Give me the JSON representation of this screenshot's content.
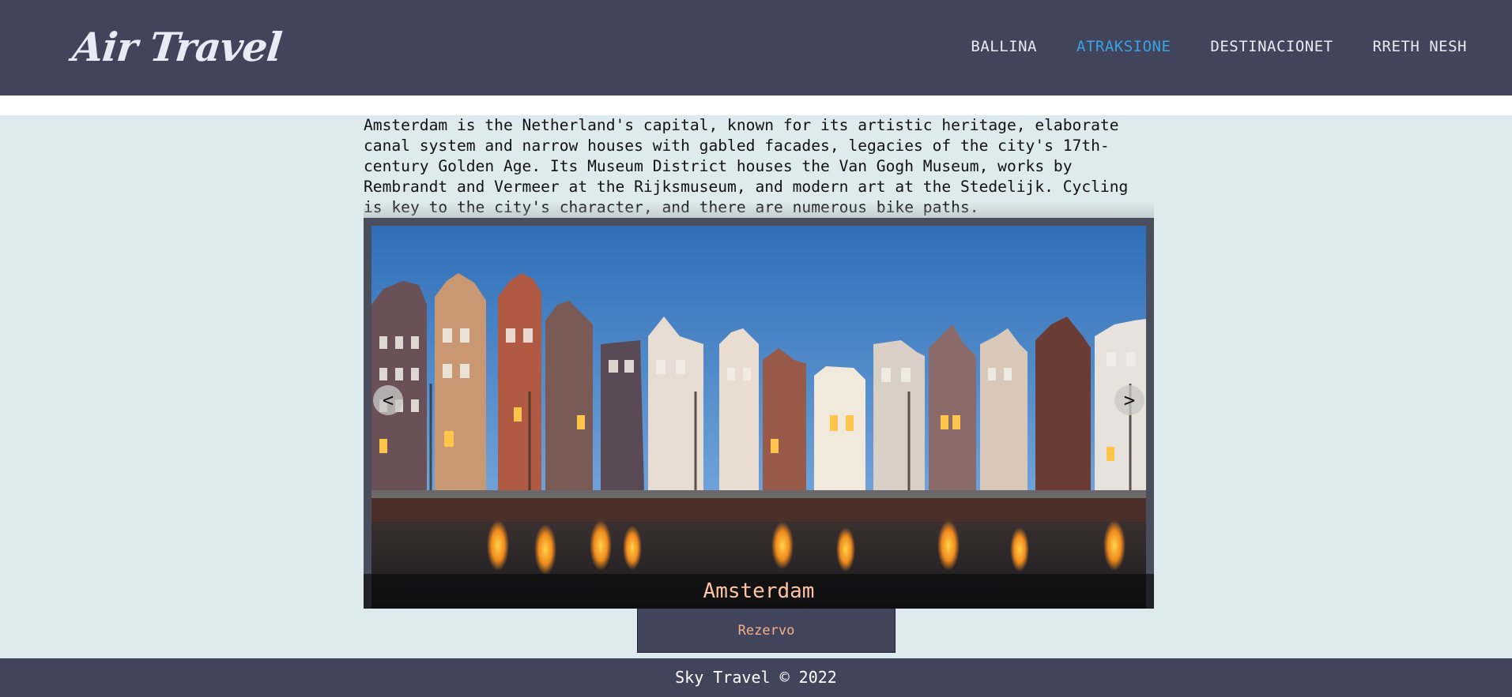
{
  "header": {
    "logo": "Air Travel",
    "nav": [
      {
        "label": "BALLINA",
        "active": false
      },
      {
        "label": "ATRAKSIONE",
        "active": true
      },
      {
        "label": "DESTINACIONET",
        "active": false
      },
      {
        "label": "RRETH NESH",
        "active": false
      }
    ]
  },
  "main": {
    "description": "Amsterdam is the Netherland's capital, known for its artistic heritage, elaborate canal system and narrow houses with gabled facades, legacies of the city's 17th-century Golden Age. Its Museum District houses the Van Gogh Museum, works by Rembrandt and Vermeer at the Rijksmuseum, and modern art at the Stedelijk. Cycling is key to the city's character, and there are numerous bike paths.",
    "slider": {
      "caption": "Amsterdam",
      "prev_label": "<",
      "next_label": ">"
    },
    "book_label": "Rezervo"
  },
  "footer": {
    "text": "Sky Travel © 2022"
  },
  "colors": {
    "header_bg": "#41445a",
    "page_bg": "#deebee",
    "nav_active": "#3aa3e6",
    "caption": "#ffc4a3",
    "button_text": "#f2b28c"
  }
}
